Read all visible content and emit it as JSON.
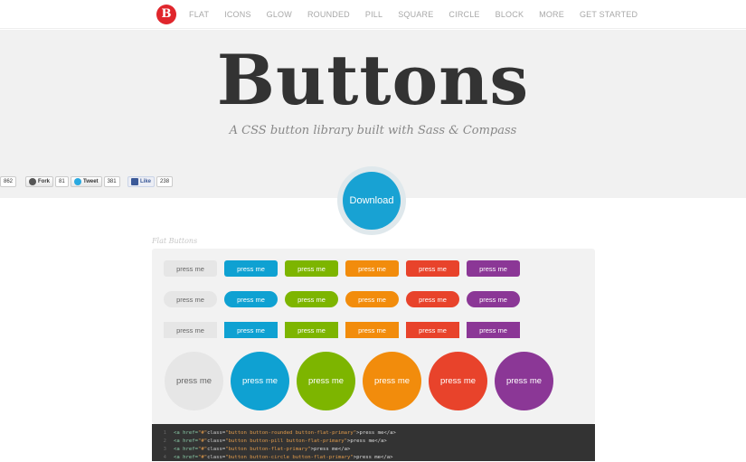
{
  "nav": {
    "logo_letter": "B",
    "items": [
      "FLAT",
      "ICONS",
      "GLOW",
      "ROUNDED",
      "PILL",
      "SQUARE",
      "CIRCLE",
      "BLOCK",
      "MORE",
      "GET STARTED"
    ]
  },
  "hero": {
    "title": "Buttons",
    "subtitle": "A CSS button library built with Sass & Compass"
  },
  "social": {
    "first_count": "862",
    "fork_label": "Fork",
    "fork_count": "81",
    "tweet_label": "Tweet",
    "tweet_count": "381",
    "like_label": "Like",
    "like_count": "238"
  },
  "download": {
    "label": "Download"
  },
  "section": {
    "title": "Flat Buttons",
    "button_label": "press me"
  },
  "code": {
    "lines": [
      {
        "n": "1",
        "open": "<a href=",
        "href": "\"#\"",
        "cls_attr": " class=",
        "cls": "\"button button-rounded button-flat-primary\"",
        "text": ">press me</a>"
      },
      {
        "n": "2",
        "open": "<a href=",
        "href": "\"#\"",
        "cls_attr": " class=",
        "cls": "\"button button-pill button-flat-primary\"",
        "text": ">press me</a>"
      },
      {
        "n": "3",
        "open": "<a href=",
        "href": "\"#\"",
        "cls_attr": " class=",
        "cls": "\"button button-flat-primary\"",
        "text": ">press me</a>"
      },
      {
        "n": "4",
        "open": "<a href=",
        "href": "\"#\"",
        "cls_attr": " class=",
        "cls": "\"button button-circle button-flat-primary\"",
        "text": ">press me</a>"
      }
    ]
  },
  "colors": {
    "primary": "#0fa1d2",
    "action": "#7db500",
    "highlight": "#f28c0c",
    "caution": "#e8432b",
    "royal": "#8b3796",
    "default": "#e6e6e6"
  }
}
